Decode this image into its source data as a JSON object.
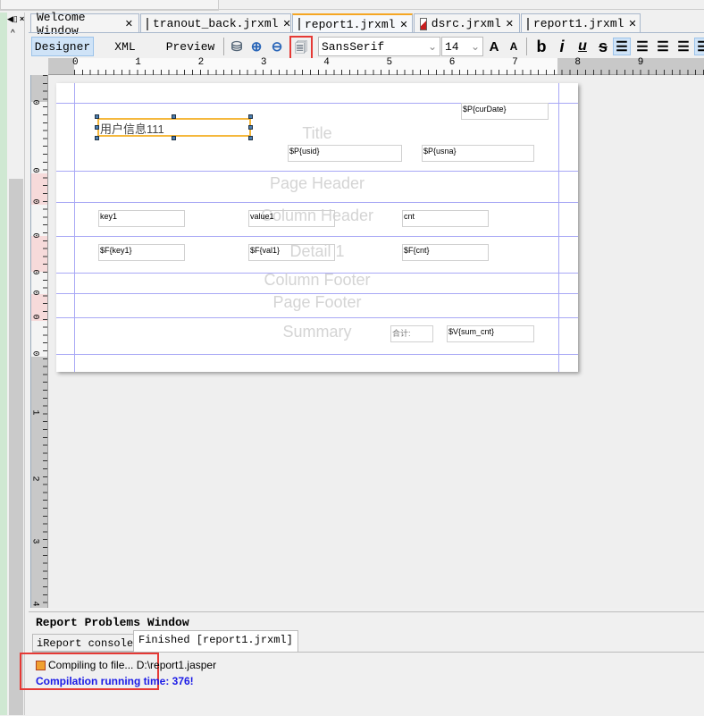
{
  "tabs": [
    {
      "label": "Welcome Window",
      "active": false
    },
    {
      "label": "tranout_back.jrxml",
      "active": false
    },
    {
      "label": "report1.jrxml",
      "active": true
    },
    {
      "label": "dsrc.jrxml",
      "active": false
    },
    {
      "label": "report1.jrxml",
      "active": false
    }
  ],
  "toolbar": {
    "designer": "Designer",
    "xml": "XML",
    "preview": "Preview",
    "font": "SansSerif",
    "size": "14",
    "bold": "b",
    "italic": "i",
    "underline": "u",
    "strike": "s"
  },
  "ruler": {
    "h": [
      "0",
      "1",
      "2",
      "3",
      "4",
      "5",
      "6",
      "7",
      "8",
      "9"
    ],
    "v": [
      "0",
      "0",
      "0",
      "0",
      "0",
      "0",
      "0",
      "0",
      "1",
      "2",
      "3",
      "4"
    ]
  },
  "report": {
    "bands": [
      "Title",
      "Page Header",
      "Column Header",
      "Detail 1",
      "Column Footer",
      "Page Footer",
      "Summary"
    ],
    "label": "用户信息111",
    "curDate": "$P{curDate}",
    "usid": "$P{usid}",
    "usna": "$P{usna}",
    "headers": [
      "key1",
      "value1",
      "cnt"
    ],
    "details": [
      "$F{key1}",
      "$F{val1}",
      "$F{cnt}"
    ],
    "sumLabel": "合计:",
    "sumValue": "$V{sum_cnt}"
  },
  "bottom": {
    "title": "Report Problems Window",
    "tabs": [
      "iReport console",
      "Finished [report1.jrxml]"
    ],
    "line1": "Compiling to file... D:\\report1.jasper",
    "line2": "Compilation running time: 376!"
  },
  "colors": {
    "highlight": "#e53935",
    "accent": "#f5a623",
    "band": "#a8a8f5",
    "status": "#1a1ae6"
  }
}
